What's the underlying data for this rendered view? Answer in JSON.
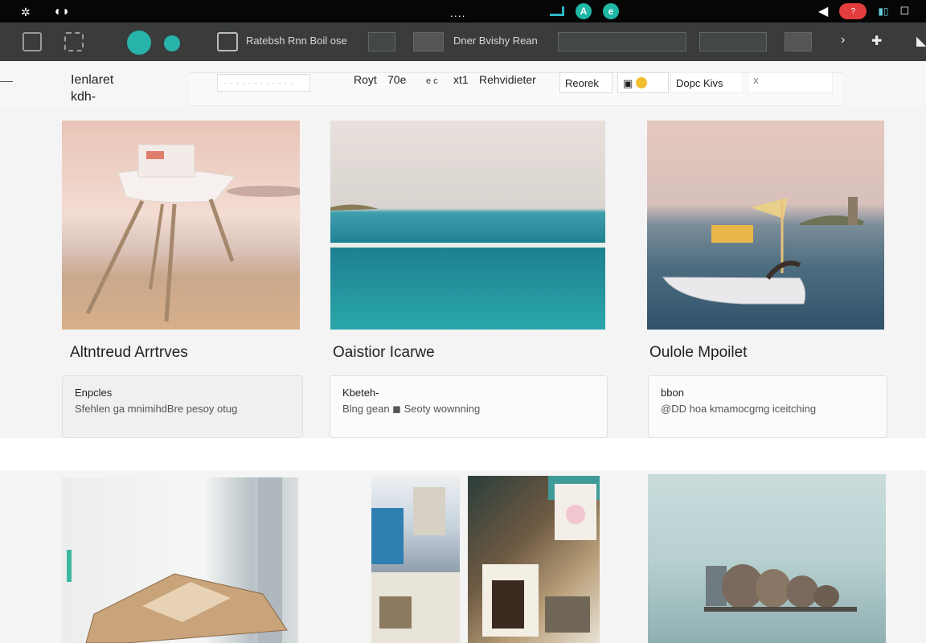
{
  "statusbar": {
    "dots": "....",
    "mid_icon_a": "A",
    "mid_icon_b": "e",
    "right_badge": "?"
  },
  "toolbar": {
    "text_a": "Ratebsh  Rnn  Boil  ose",
    "text_b": "Dner  Bvishy  Rean",
    "icon_names": [
      "window-icon",
      "doc-icon",
      "media-icon",
      "leaf-icon",
      "thumbnail-icon",
      "grid-icon",
      "chevron-icon",
      "pin-icon",
      "chat-icon"
    ]
  },
  "subheader": {
    "site_title": "Ienlaret\nkdh-",
    "filter_placeholder": "· · ·  ·  · · ·  · · · ·  ·",
    "filters": {
      "a": "Royt",
      "b": "70e",
      "c": "e c",
      "d": "xt1",
      "e": "Rehvidieter",
      "f": "Reorek",
      "g": "Dopc Kivs",
      "h": "X"
    }
  },
  "cards": [
    {
      "title": "Altntreud Arrtrves",
      "label": "Enpcles",
      "meta": "Sfehlen ga mnimihdBre pesoy otug"
    },
    {
      "title": "Oaistior Icarwe",
      "label": "Kbeteh-",
      "meta": "Blng gean  ◼ Seoty  wownning"
    },
    {
      "title": "Oulole Mpoilet",
      "label": "bbon",
      "meta": "@DD hoa kmamocgmg  iceitching"
    }
  ]
}
